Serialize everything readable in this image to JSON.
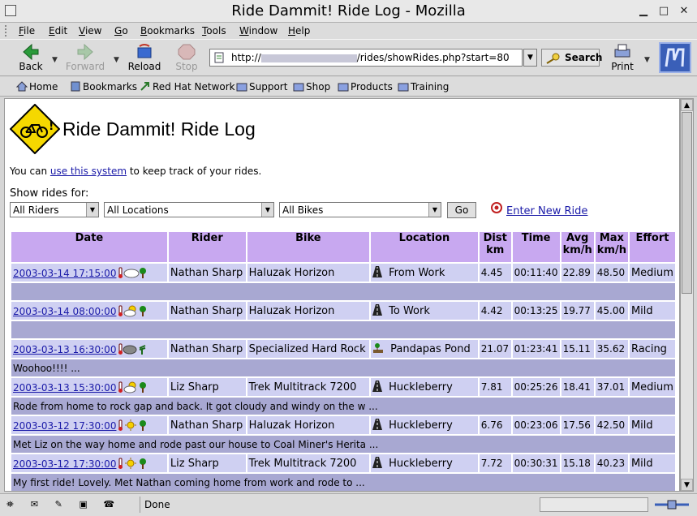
{
  "window": {
    "title": "Ride Dammit! Ride Log - Mozilla"
  },
  "menu": [
    "File",
    "Edit",
    "View",
    "Go",
    "Bookmarks",
    "Tools",
    "Window",
    "Help"
  ],
  "nav": {
    "back": "Back",
    "forward": "Forward",
    "reload": "Reload",
    "stop": "Stop",
    "url_prefix": "http://",
    "url_suffix": "/rides/showRides.php?start=80",
    "search": "Search",
    "print": "Print"
  },
  "personal_toolbar": [
    "Home",
    "Bookmarks",
    "Red Hat Network",
    "Support",
    "Shop",
    "Products",
    "Training"
  ],
  "page": {
    "title": "Ride Dammit! Ride Log",
    "intro_before": "You can ",
    "intro_link": "use this system",
    "intro_after": " to keep track of your rides.",
    "show_rides_for": "Show rides for:",
    "filter_riders": "All Riders",
    "filter_locations": "All Locations",
    "filter_bikes": "All Bikes",
    "go": "Go",
    "enter_new_ride": "Enter New Ride"
  },
  "table": {
    "headers": [
      "Date",
      "Rider",
      "Bike",
      "Location",
      "Dist km",
      "Time",
      "Avg km/h",
      "Max km/h",
      "Effort"
    ],
    "rows": [
      {
        "date": "2003-03-14 17:15:00",
        "weather": "cloudy",
        "rider": "Nathan Sharp",
        "bike": "Haluzak Horizon",
        "loc_type": "road",
        "location": "From Work",
        "dist": "4.45",
        "time": "00:11:40",
        "avg": "22.89",
        "max": "48.50",
        "effort": "Medium",
        "note": ""
      },
      {
        "date": "2003-03-14 08:00:00",
        "weather": "partly-sunny",
        "rider": "Nathan Sharp",
        "bike": "Haluzak Horizon",
        "loc_type": "road",
        "location": "To Work",
        "dist": "4.42",
        "time": "00:13:25",
        "avg": "19.77",
        "max": "45.00",
        "effort": "Mild",
        "note": ""
      },
      {
        "date": "2003-03-13 16:30:00",
        "weather": "windy-cloudy",
        "rider": "Nathan Sharp",
        "bike": "Specialized Hard Rock",
        "loc_type": "trail",
        "location": "Pandapas Pond",
        "dist": "21.07",
        "time": "01:23:41",
        "avg": "15.11",
        "max": "35.62",
        "effort": "Racing",
        "note": "Woohoo!!!! ..."
      },
      {
        "date": "2003-03-13 15:30:00",
        "weather": "partly-sunny",
        "rider": "Liz Sharp",
        "bike": "Trek Multitrack 7200",
        "loc_type": "road",
        "location": "Huckleberry",
        "dist": "7.81",
        "time": "00:25:26",
        "avg": "18.41",
        "max": "37.01",
        "effort": "Medium",
        "note": "Rode from home to rock gap and back.  It got cloudy and windy on the w ..."
      },
      {
        "date": "2003-03-12 17:30:00",
        "weather": "sunny",
        "rider": "Nathan Sharp",
        "bike": "Haluzak Horizon",
        "loc_type": "road",
        "location": "Huckleberry",
        "dist": "6.76",
        "time": "00:23:06",
        "avg": "17.56",
        "max": "42.50",
        "effort": "Mild",
        "note": "Met Liz on the way home and rode past our house to Coal Miner's Herita ..."
      },
      {
        "date": "2003-03-12 17:30:00",
        "weather": "sunny",
        "rider": "Liz Sharp",
        "bike": "Trek Multitrack 7200",
        "loc_type": "road",
        "location": "Huckleberry",
        "dist": "7.72",
        "time": "00:30:31",
        "avg": "15.18",
        "max": "40.23",
        "effort": "Mild",
        "note": "My first ride!  Lovely.  Met Nathan coming home from work and rode to  ..."
      }
    ]
  },
  "status": {
    "text": "Done"
  }
}
